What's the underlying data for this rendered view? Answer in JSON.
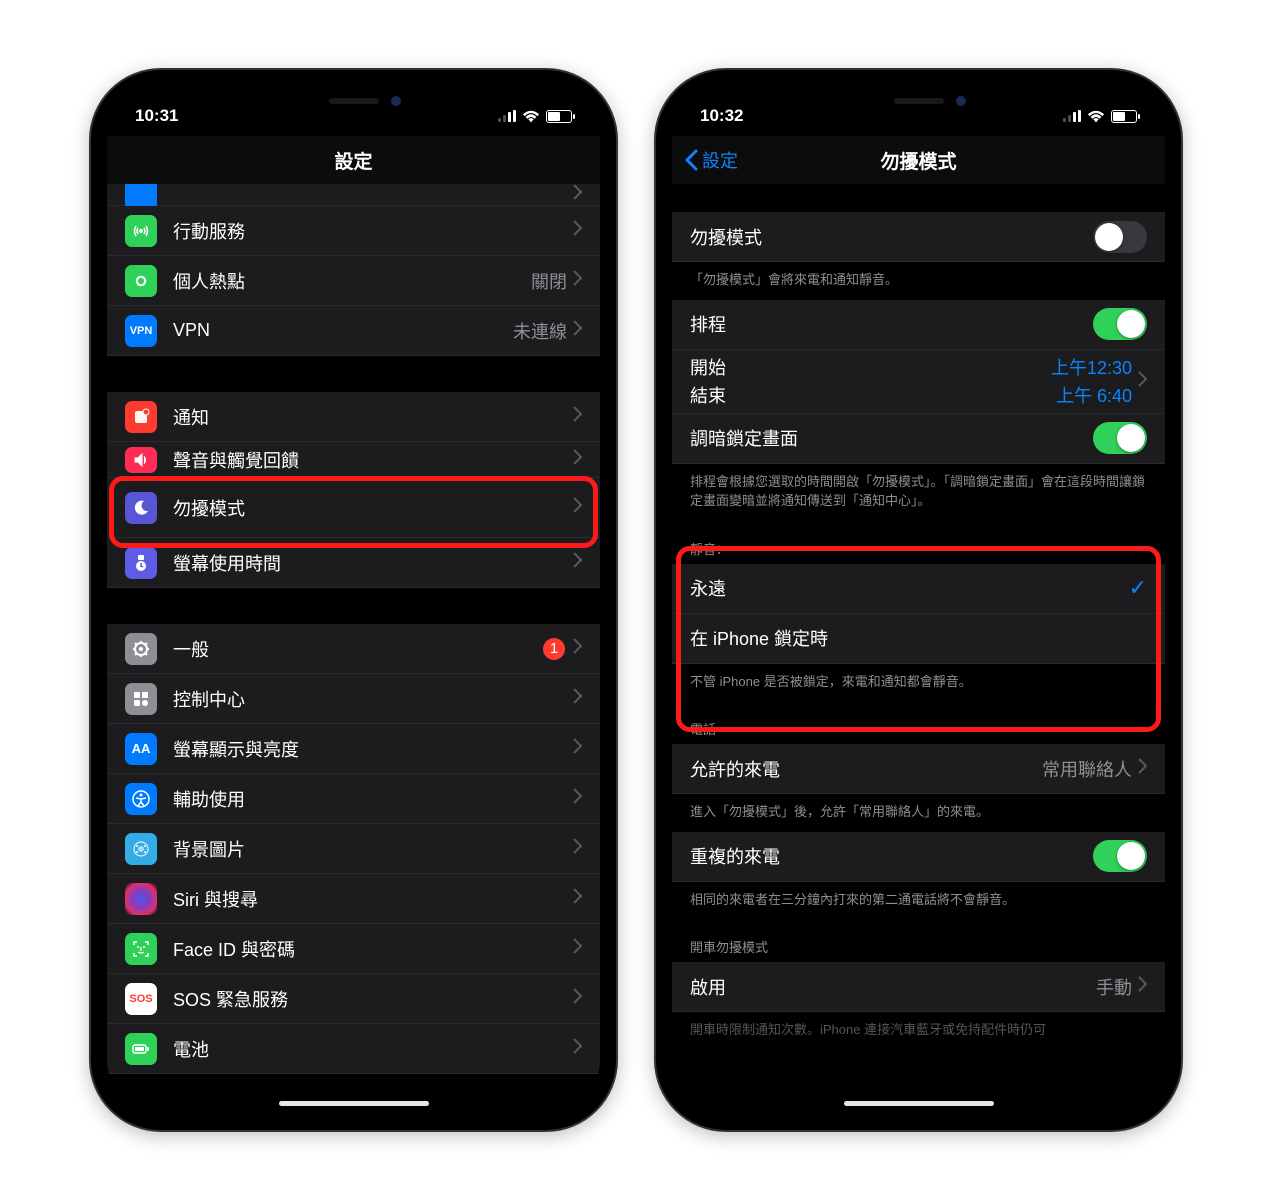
{
  "left": {
    "status_time": "10:31",
    "title": "設定",
    "rows": [
      {
        "icon": "cellular-icon",
        "bg": "bg-green",
        "label": "行動服務"
      },
      {
        "icon": "hotspot-icon",
        "bg": "bg-greenlink",
        "label": "個人熱點",
        "detail": "關閉"
      },
      {
        "icon": "vpn-icon",
        "bg": "bg-blue",
        "label": "VPN",
        "detail": "未連線"
      }
    ],
    "rows2": [
      {
        "icon": "notifications-icon",
        "bg": "bg-red",
        "label": "通知"
      },
      {
        "icon": "sounds-icon",
        "bg": "bg-pinkred",
        "label": "聲音與觸覺回饋"
      },
      {
        "icon": "dnd-icon",
        "bg": "bg-purple",
        "label": "勿擾模式"
      },
      {
        "icon": "screentime-icon",
        "bg": "bg-indigo",
        "label": "螢幕使用時間"
      }
    ],
    "rows3": [
      {
        "icon": "general-icon",
        "bg": "bg-gray",
        "label": "一般",
        "badge": "1"
      },
      {
        "icon": "control-center-icon",
        "bg": "bg-graylight",
        "label": "控制中心"
      },
      {
        "icon": "display-icon",
        "bg": "bg-darkblue",
        "label": "螢幕顯示與亮度"
      },
      {
        "icon": "accessibility-icon",
        "bg": "bg-blue",
        "label": "輔助使用"
      },
      {
        "icon": "wallpaper-icon",
        "bg": "bg-cyan",
        "label": "背景圖片"
      },
      {
        "icon": "siri-icon",
        "bg": "bg-black",
        "label": "Siri 與搜尋"
      },
      {
        "icon": "faceid-icon",
        "bg": "bg-facegreen",
        "label": "Face ID 與密碼"
      },
      {
        "icon": "sos-icon",
        "bg": "bg-soswhite",
        "label": "SOS 緊急服務"
      },
      {
        "icon": "battery-icon",
        "bg": "bg-battery",
        "label": "電池"
      }
    ]
  },
  "right": {
    "status_time": "10:32",
    "back_label": "設定",
    "title": "勿擾模式",
    "dnd_label": "勿擾模式",
    "dnd_footer": "「勿擾模式」會將來電和通知靜音。",
    "schedule_label": "排程",
    "start_label": "開始",
    "start_value": "上午12:30",
    "end_label": "結束",
    "end_value": "上午 6:40",
    "dim_label": "調暗鎖定畫面",
    "schedule_footer": "排程會根據您選取的時間開啟「勿擾模式」。「調暗鎖定畫面」會在這段時間讓鎖定畫面變暗並將通知傳送到「通知中心」。",
    "silence_header": "靜音：",
    "silence_always": "永遠",
    "silence_locked": "在 iPhone 鎖定時",
    "silence_footer": "不管 iPhone 是否被鎖定，來電和通知都會靜音。",
    "phone_header": "電話",
    "allow_calls_label": "允許的來電",
    "allow_calls_value": "常用聯絡人",
    "allow_calls_footer": "進入「勿擾模式」後，允許「常用聯絡人」的來電。",
    "repeat_label": "重複的來電",
    "repeat_footer": "相同的來電者在三分鐘內打來的第二通電話將不會靜音。",
    "driving_header": "開車勿擾模式",
    "enable_label": "啟用",
    "enable_value": "手動",
    "driving_footer": "開車時限制通知次數。iPhone 連接汽車藍牙或免持配件時仍可"
  }
}
